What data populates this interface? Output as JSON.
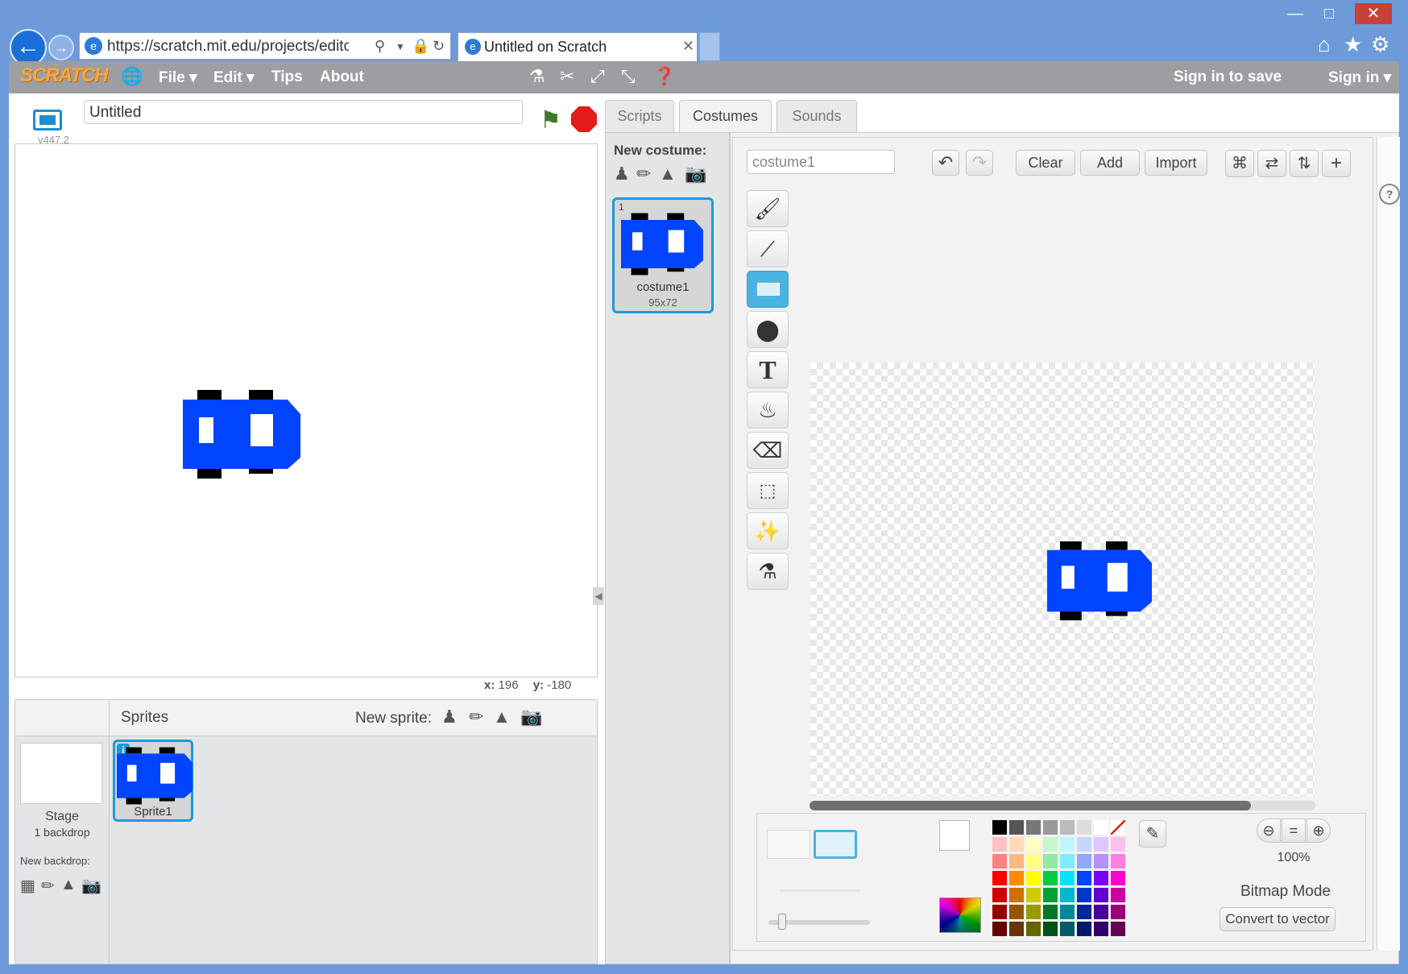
{
  "browser": {
    "url": "https://scratch.mit.edu/projects/editor/#e",
    "tab_title": "Untitled on Scratch"
  },
  "menubar": {
    "logo": "SCRATCH",
    "file": "File ▾",
    "edit": "Edit ▾",
    "tips": "Tips",
    "about": "About",
    "sign_in_to_save": "Sign in to save",
    "sign_in": "Sign in ▾"
  },
  "stage": {
    "project_title": "Untitled",
    "version": "v447.2",
    "x_label": "x:",
    "x_value": "196",
    "y_label": "y:",
    "y_value": "-180"
  },
  "sprites_pane": {
    "title": "Sprites",
    "new_sprite_label": "New sprite:",
    "stage_label": "Stage",
    "backdrop_count": "1 backdrop",
    "new_backdrop_label": "New backdrop:",
    "sprites": [
      {
        "name": "Sprite1"
      }
    ]
  },
  "editor_tabs": [
    "Scripts",
    "Costumes",
    "Sounds"
  ],
  "costumes_pane": {
    "new_costume_label": "New costume:",
    "costumes": [
      {
        "index": "1",
        "name": "costume1",
        "size": "95x72"
      }
    ]
  },
  "paint_editor": {
    "costume_name_value": "costume1",
    "clear_label": "Clear",
    "add_label": "Add",
    "import_label": "Import",
    "zoom_level": "100%",
    "mode_label": "Bitmap Mode",
    "convert_label": "Convert to vector",
    "selected_tool": "rectangle"
  },
  "palette": {
    "rows": [
      [
        "#000000",
        "#555555",
        "#777777",
        "#999999",
        "#bbbbbb",
        "#dddddd",
        "#ffffff",
        "none"
      ],
      [
        "#ffc0c0",
        "#ffd9b8",
        "#ffffc0",
        "#c8f5d0",
        "#c0f5ff",
        "#c8d6ff",
        "#dcc8ff",
        "#ffc0f0"
      ],
      [
        "#ff8080",
        "#ffb880",
        "#ffff80",
        "#90eba0",
        "#80ecff",
        "#90a8ff",
        "#b890ff",
        "#ff80e0"
      ],
      [
        "#ff0000",
        "#ff8c00",
        "#ffff00",
        "#00cc44",
        "#00e5ff",
        "#0044ff",
        "#7a00ff",
        "#ff00cc"
      ],
      [
        "#cc0000",
        "#cc7000",
        "#cccc00",
        "#00a035",
        "#00b8cc",
        "#0036cc",
        "#6200cc",
        "#cc00a0"
      ],
      [
        "#990000",
        "#995400",
        "#999900",
        "#007828",
        "#008a99",
        "#002899",
        "#490099",
        "#990078"
      ],
      [
        "#660000",
        "#663800",
        "#666600",
        "#005019",
        "#005c66",
        "#001b66",
        "#310066",
        "#660050"
      ]
    ],
    "car_blue": "#0044ff"
  }
}
